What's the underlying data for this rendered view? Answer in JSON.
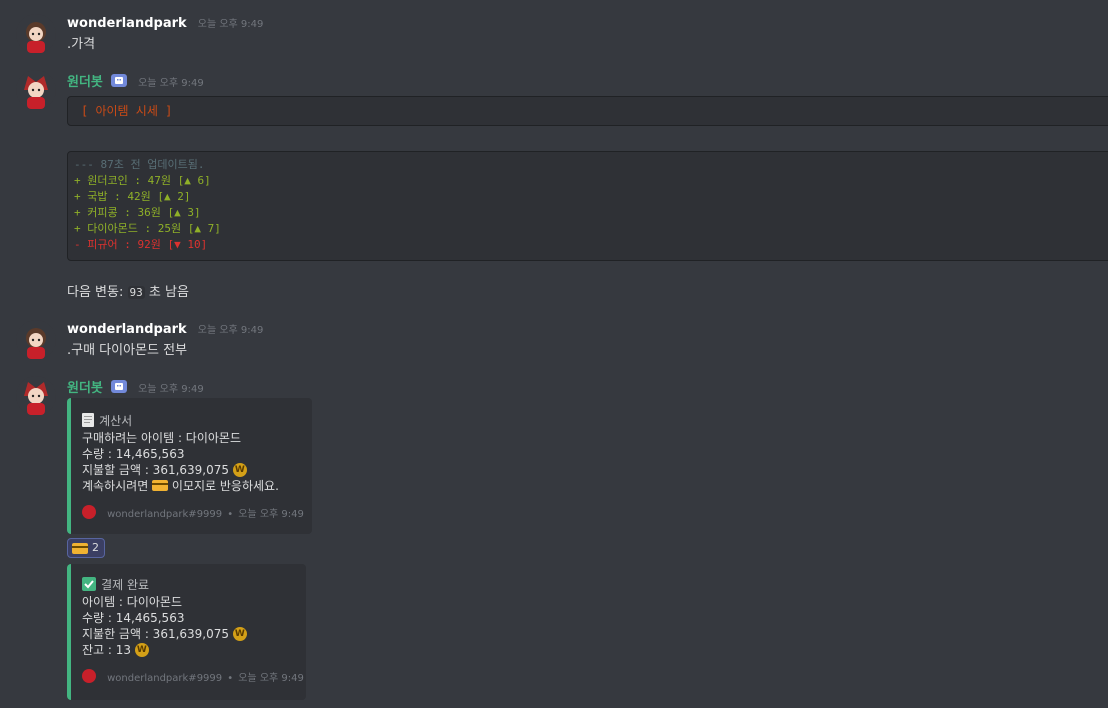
{
  "messages": [
    {
      "author": "wonderlandpark",
      "timestamp": "오늘 오후 9:49",
      "text": ".가격"
    },
    {
      "author": "원더봇",
      "timestamp": "오늘 오후 9:49",
      "is_bot": true
    },
    {
      "author": "wonderlandpark",
      "timestamp": "오늘 오후 9:49",
      "text": ".구매 다이아몬드 전부"
    },
    {
      "author": "원더봇",
      "timestamp": "오늘 오후 9:49",
      "is_bot": true
    }
  ],
  "price_block": {
    "header": "[ 아이템 시세 ]",
    "updated": "--- 87초 전 업데이트됨.",
    "lines": [
      {
        "text": "+ 원더코인 : 47원 [▲ 6]",
        "color": "#8fb028"
      },
      {
        "text": "+ 국밥 : 42원 [▲ 2]",
        "color": "#8fb028"
      },
      {
        "text": "+ 커피콩 : 36원 [▲ 3]",
        "color": "#8fb028"
      },
      {
        "text": "+ 다이아몬드 : 25원 [▲ 7]",
        "color": "#8fb028"
      },
      {
        "text": "- 피규어 : 92원 [▼ 10]",
        "color": "#dc322f"
      }
    ]
  },
  "next_change": {
    "prefix": "다음 변동:",
    "value": "93",
    "suffix": "초 남음"
  },
  "invoice_embed": {
    "title": "계산서",
    "item_line": "구매하려는 아이템 : 다이아몬드",
    "qty_line": "수량 : 14,465,563",
    "pay_line": "지불할 금액 : 361,639,075",
    "confirm_prefix": "계속하시려면",
    "confirm_suffix": "이모지로 반응하세요.",
    "footer_user": "wonderlandpark#9999",
    "footer_time": "오늘 오후 9:49"
  },
  "reaction": {
    "count": "2",
    "emoji": "credit-card"
  },
  "receipt_embed": {
    "title": "결제 완료",
    "item_line": "아이템 : 다이아몬드",
    "qty_line": "수량 : 14,465,563",
    "paid_line": "지불한 금액 : 361,639,075",
    "balance_line": "잔고 : 13",
    "footer_user": "wonderlandpark#9999",
    "footer_time": "오늘 오후 9:49"
  },
  "colors": {
    "background": "#36393f",
    "embed_bar": "#43b581",
    "bot_name": "#43b581",
    "code_header": "#cb4b16",
    "coin": "#d4a017"
  }
}
